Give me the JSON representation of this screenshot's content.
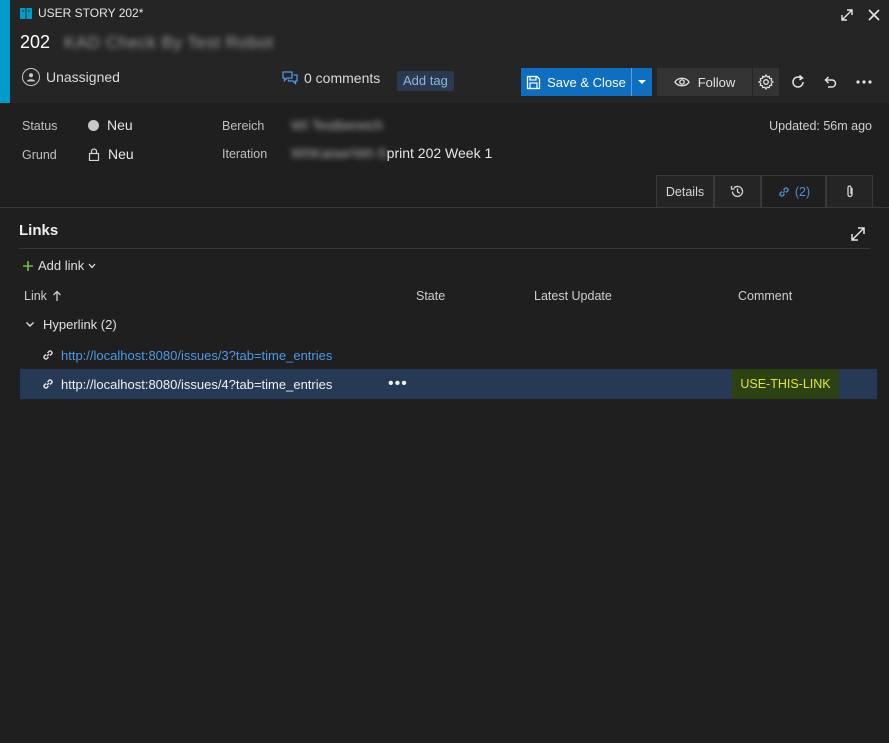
{
  "header": {
    "work_item_type": "USER STORY 202*",
    "id": "202",
    "title": "KAD Check By Test Robot",
    "assigned_to": "Unassigned",
    "comments": "0 comments",
    "add_tag": "Add tag",
    "save_close": "Save & Close",
    "follow": "Follow"
  },
  "fields": {
    "status_label": "Status",
    "status_value": "Neu",
    "grund_label": "Grund",
    "grund_value": "Neu",
    "bereich_label": "Bereich",
    "bereich_value": "WI Testbereich",
    "iteration_label": "Iteration",
    "iteration_prefix": "WI\\Kaiser\\WI-S",
    "iteration_value": "print 202 Week 1",
    "updated": "Updated: 56m ago"
  },
  "tabs": {
    "details": "Details",
    "links_count": "(2)"
  },
  "links": {
    "title": "Links",
    "add_link": "Add link",
    "columns": {
      "link": "Link",
      "state": "State",
      "latest_update": "Latest Update",
      "comment": "Comment"
    },
    "group": "Hyperlink (2)",
    "rows": [
      {
        "url": "http://localhost:8080/issues/3?tab=time_entries",
        "comment": ""
      },
      {
        "url": "http://localhost:8080/issues/4?tab=time_entries",
        "comment": "USE-THIS-LINK",
        "more": "•••"
      }
    ]
  },
  "colors": {
    "accent": "#009ccc",
    "primary_button": "#0e6ebf",
    "selected_row": "#263a55",
    "comment_highlight_bg": "#2d4214",
    "comment_highlight_text": "#e3e337"
  }
}
